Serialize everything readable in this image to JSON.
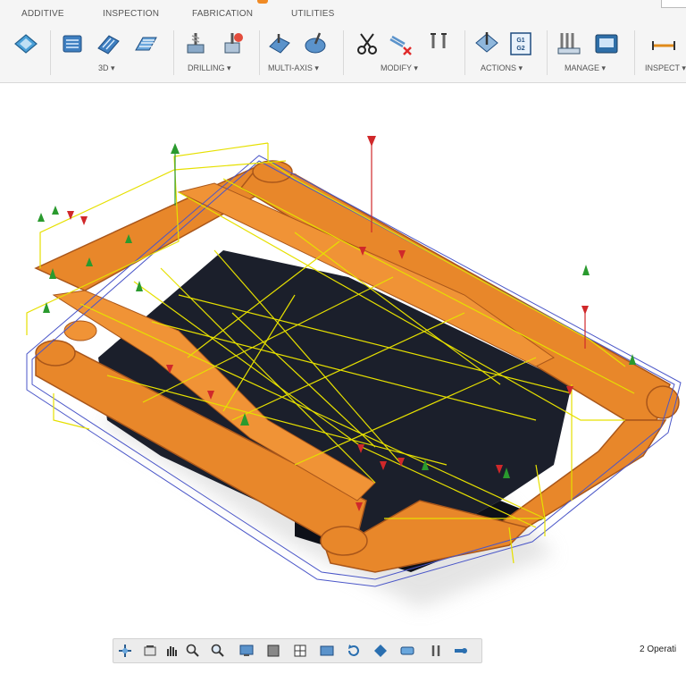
{
  "ribbon": {
    "tabs": [
      {
        "label": "ADDITIVE"
      },
      {
        "label": "INSPECTION"
      },
      {
        "label": "FABRICATION"
      },
      {
        "label": "UTILITIES"
      }
    ],
    "groups": [
      {
        "label": "3D ▾"
      },
      {
        "label": "DRILLING ▾"
      },
      {
        "label": "MULTI-AXIS ▾"
      },
      {
        "label": "MODIFY ▾"
      },
      {
        "label": "ACTIONS ▾"
      },
      {
        "label": "MANAGE ▾"
      },
      {
        "label": "INSPECT ▾"
      }
    ],
    "icons": {
      "g0": [
        "surface-icon"
      ],
      "g3d": [
        "pocket-3d-icon",
        "adaptive-3d-icon",
        "parallel-3d-icon"
      ],
      "drilling": [
        "drill-icon",
        "drill-probe-icon"
      ],
      "multiaxis": [
        "swarf-icon",
        "multiaxis-contour-icon"
      ],
      "modify": [
        "scissors-icon",
        "delete-toolpath-icon",
        "tool-icon"
      ],
      "actions": [
        "simulate-icon",
        "post-process-icon"
      ],
      "manage": [
        "tool-library-icon",
        "machine-icon"
      ],
      "inspect": [
        "measure-icon"
      ]
    },
    "postprocess_glyph": "G1 G2"
  },
  "navbar": {
    "icons": [
      "orbit-icon",
      "look-at-icon",
      "pan-icon",
      "zoom-window-icon",
      "zoom-icon",
      "display-settings-icon",
      "visual-style-icon",
      "grid-icon",
      "viewports-icon",
      "rotate-icon",
      "view-cube-icon",
      "environment-icon",
      "effects-icon",
      "object-visibility-icon"
    ]
  },
  "status": {
    "text": "2 Operati"
  },
  "colors": {
    "part_orange": "#e8872a",
    "part_shadow": "#a9561a",
    "stock_dark": "#1b1f2b",
    "toolpath_yellow": "#e6e000",
    "contour_blue": "#4a56c8",
    "retract_red": "#d0282a",
    "plunge_green": "#2a9a2e"
  }
}
